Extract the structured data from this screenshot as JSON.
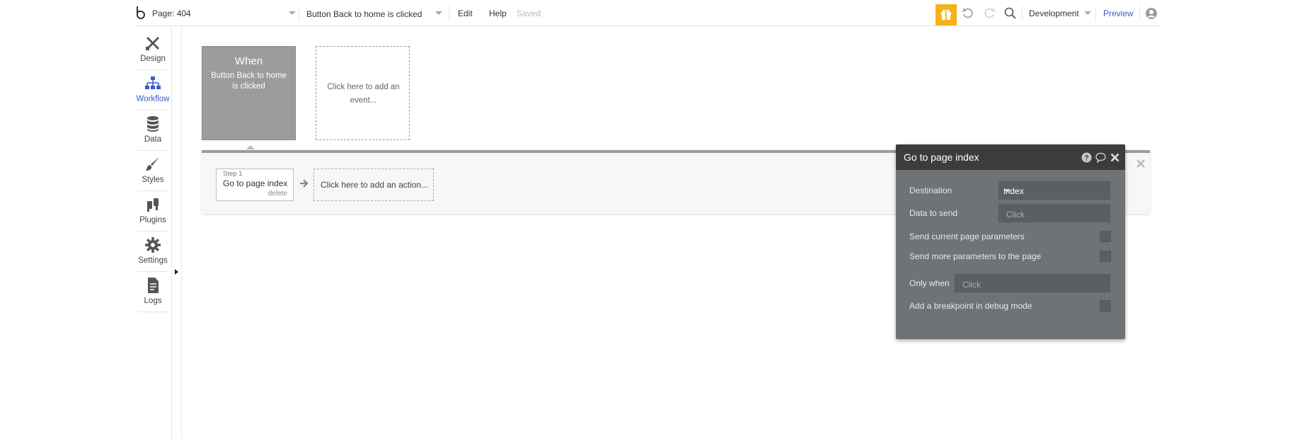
{
  "topbar": {
    "page_label": "Page: 404",
    "event_selector": "Button Back to home is clicked",
    "menu_edit": "Edit",
    "menu_help": "Help",
    "save_status": "Saved",
    "environment": "Development",
    "preview": "Preview"
  },
  "sidebar": {
    "items": [
      {
        "label": "Design",
        "icon": "design-icon"
      },
      {
        "label": "Workflow",
        "icon": "workflow-icon",
        "active": true
      },
      {
        "label": "Data",
        "icon": "database-icon"
      },
      {
        "label": "Styles",
        "icon": "brush-icon"
      },
      {
        "label": "Plugins",
        "icon": "plug-icon"
      },
      {
        "label": "Settings",
        "icon": "gear-icon"
      },
      {
        "label": "Logs",
        "icon": "document-icon"
      }
    ]
  },
  "workflow": {
    "event_card": {
      "title": "When",
      "description": "Button Back to home is clicked"
    },
    "add_event": "Click here to add an event...",
    "steps": [
      {
        "step_no": "Step 1",
        "name": "Go to page index",
        "delete": "delete"
      }
    ],
    "add_action": "Click here to add an action..."
  },
  "property_editor": {
    "title": "Go to page index",
    "destination_label": "Destination",
    "destination_value": "index",
    "data_to_send_label": "Data to send",
    "data_to_send_placeholder": "Click",
    "send_current_params_label": "Send current page parameters",
    "send_more_params_label": "Send more parameters to the page",
    "only_when_label": "Only when",
    "only_when_placeholder": "Click",
    "breakpoint_label": "Add a breakpoint in debug mode"
  },
  "colors": {
    "accent": "#3c5ccb",
    "gift": "#f5b21b",
    "event_card": "#9c9c9c",
    "editor_bg": "#6f7375",
    "editor_header": "#3c3c3c"
  }
}
